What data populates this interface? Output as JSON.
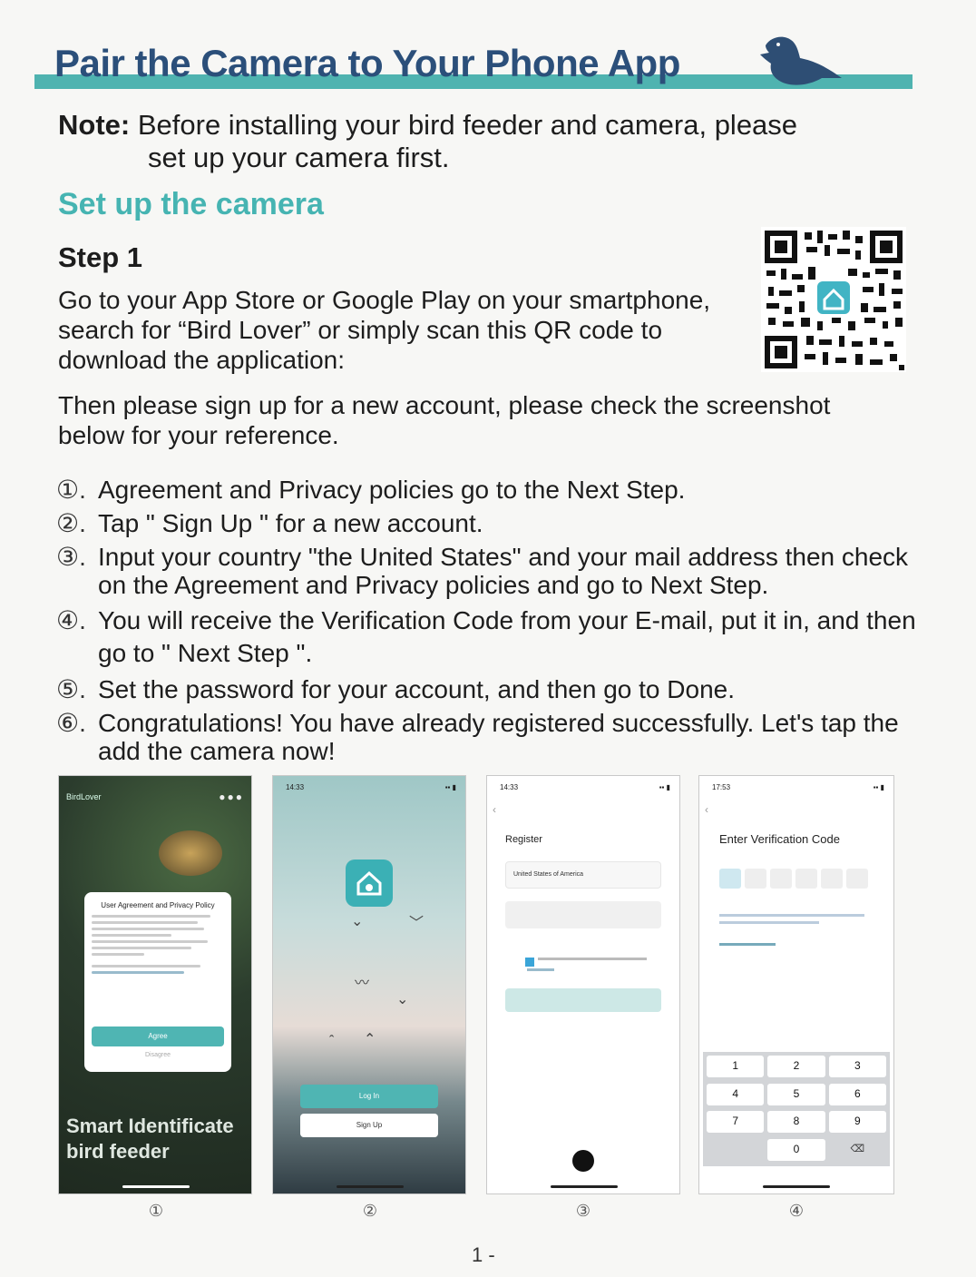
{
  "header": {
    "title": "Pair the Camera to Your Phone App"
  },
  "note": {
    "label": "Note:",
    "line1": "Before installing your bird feeder and camera, please",
    "line2": "set up your camera first."
  },
  "section": {
    "title": "Set up the camera"
  },
  "step1": {
    "title": "Step 1",
    "text": "Go to your App Store or Google Play on your smartphone, search for “Bird Lover” or simply scan this QR code to download the application:",
    "text2": "Then please sign up for a new account, please check the screenshot below for your reference."
  },
  "steps": [
    {
      "num": "①.",
      "text": "Agreement and Privacy policies go to the Next Step."
    },
    {
      "num": "②.",
      "text": "Tap \" Sign Up \" for a new account."
    },
    {
      "num": "③.",
      "text": "Input your country \"the United States\" and your mail address then check on the Agreement and Privacy policies and go to Next Step."
    },
    {
      "num": "④.",
      "text": "You will receive the Verification Code from your E-mail, put it in, and then go to \" Next Step \"."
    },
    {
      "num": "⑤.",
      "text": "Set the password for your account, and then go to Done."
    },
    {
      "num": "⑥.",
      "text": "Congratulations! You have already registered successfully. Let's tap the add the camera now!"
    }
  ],
  "screens": {
    "s1": {
      "app_label": "BirdLover",
      "dialog_title": "User Agreement and Privacy Policy",
      "agree": "Agree",
      "disagree": "Disagree",
      "brand_line1": "Smart Identificate",
      "brand_line2": "bird feeder",
      "caption": "①"
    },
    "s2": {
      "time": "14:33",
      "login": "Log In",
      "signup": "Sign Up",
      "caption": "②"
    },
    "s3": {
      "time": "14:33",
      "title": "Register",
      "country": "United States of America",
      "caption": "③"
    },
    "s4": {
      "time": "17:53",
      "title": "Enter Verification Code",
      "keys": [
        "1",
        "2",
        "3",
        "4",
        "5",
        "6",
        "7",
        "8",
        "9",
        "",
        "0",
        "⌫"
      ],
      "caption": "④"
    }
  },
  "page_number": "1 -",
  "colors": {
    "accent": "#4fb3b0",
    "title": "#2b4f7a"
  }
}
